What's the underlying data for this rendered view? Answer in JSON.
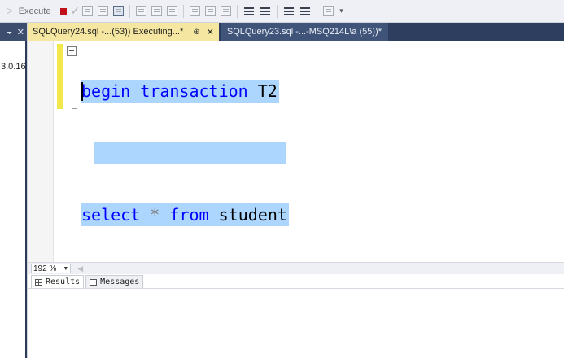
{
  "toolbar": {
    "execute_label": "Execute",
    "execute_underline": "x"
  },
  "leftdock": {
    "pin_icon": "⨪",
    "close_icon": "✕",
    "truncated_text": "3.0.16"
  },
  "tabs": {
    "active": {
      "label": "SQLQuery24.sql -...(53)) Executing...*",
      "pin": "⊕",
      "close": "✕"
    },
    "inactive": {
      "label": "SQLQuery23.sql -...-MSQ214L\\a (55))*"
    }
  },
  "editor": {
    "lines": [
      {
        "kw1": "begin",
        "kw2": "transaction",
        "ident": "T2"
      },
      {},
      {
        "kw1": "select",
        "op": "*",
        "kw2": "from",
        "ident": "student"
      }
    ]
  },
  "zoom": {
    "value": "192 %"
  },
  "results": {
    "tab_results": "Results",
    "tab_messages": "Messages"
  },
  "colors": {
    "keyword": "#0000ff",
    "selection": "#add6ff",
    "active_tab": "#f5e7a1",
    "tab_strip": "#2d3e5e"
  }
}
